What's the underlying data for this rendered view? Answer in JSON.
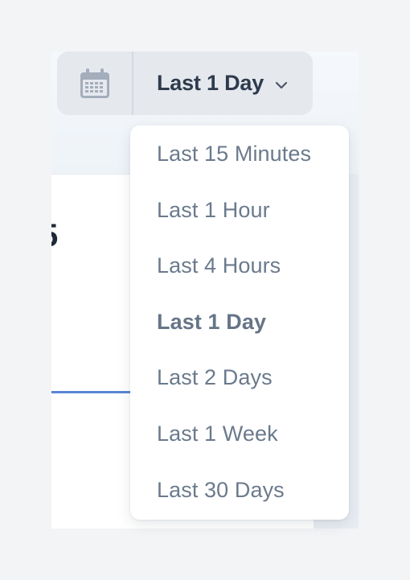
{
  "time_picker": {
    "icon": "calendar-icon",
    "selected_label": "Last 1 Day",
    "toggle_icon": "chevron-down-icon",
    "colors": {
      "background": "#e5e9ee",
      "label": "#2f3b4d",
      "icon": "#a3adbb"
    }
  },
  "dropdown": {
    "items": [
      {
        "label": "Last 15 Minutes",
        "selected": false
      },
      {
        "label": "Last 1 Hour",
        "selected": false
      },
      {
        "label": "Last 4 Hours",
        "selected": false
      },
      {
        "label": "Last 1 Day",
        "selected": true
      },
      {
        "label": "Last 2 Days",
        "selected": false
      },
      {
        "label": "Last 1 Week",
        "selected": false
      },
      {
        "label": "Last 30 Days",
        "selected": false
      }
    ],
    "colors": {
      "text": "#6b7a8c",
      "background": "#ffffff"
    }
  },
  "background_card": {
    "value_fragment": "5",
    "line_color": "#5b86d4"
  }
}
